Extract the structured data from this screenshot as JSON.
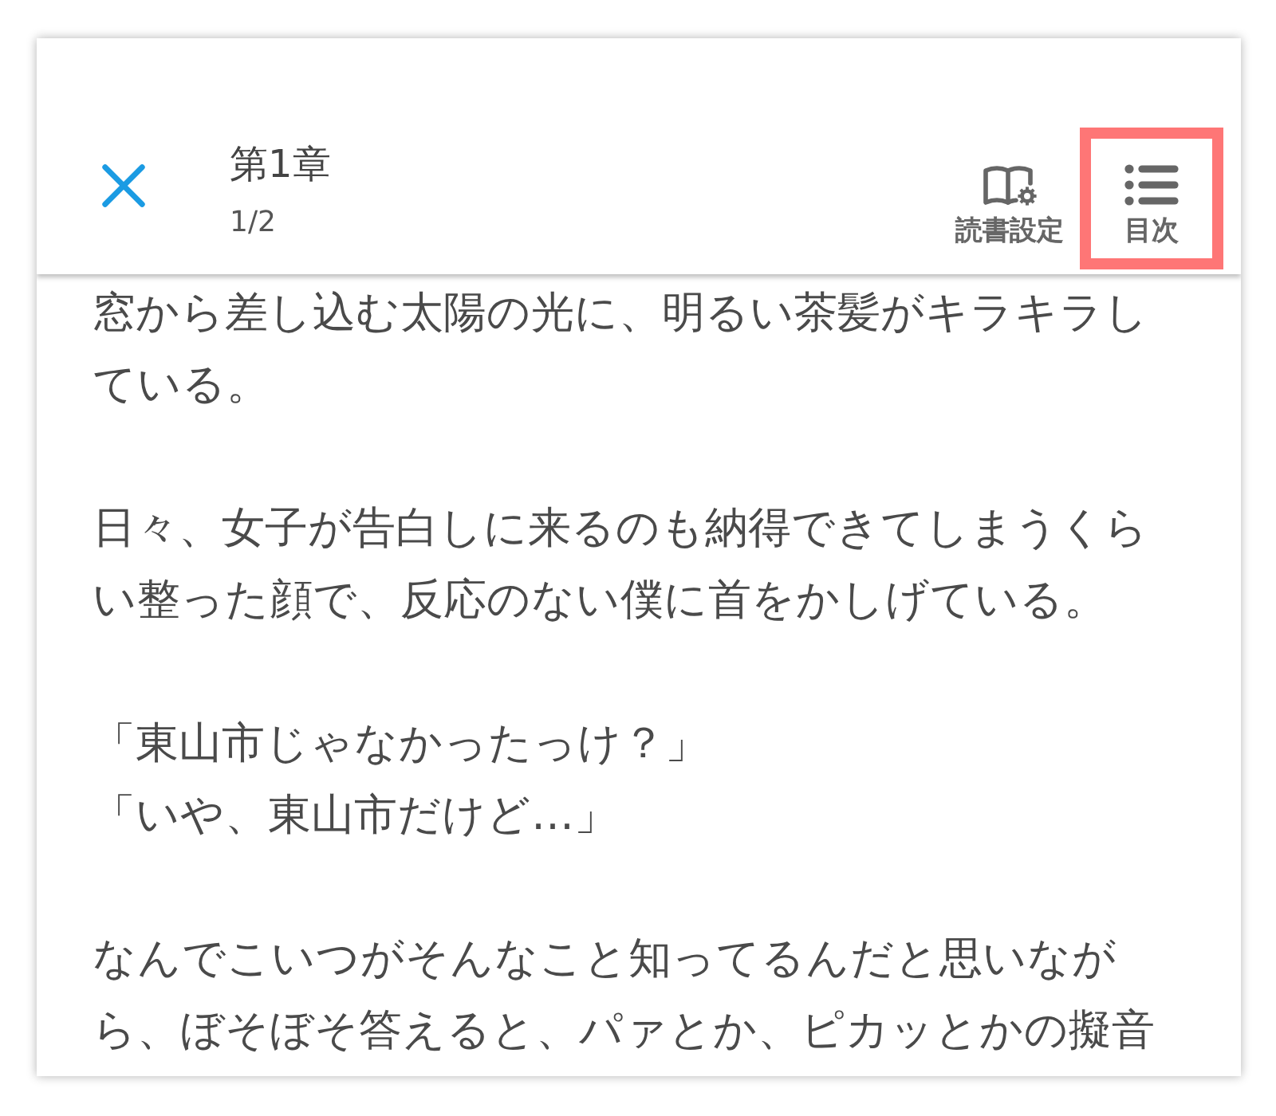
{
  "header": {
    "title": "第1章",
    "page": "1/2",
    "actions": [
      {
        "kind": "reading_settings",
        "label": "読書設定",
        "highlighted": false
      },
      {
        "kind": "contents",
        "label": "目次",
        "highlighted": true
      }
    ]
  },
  "body": [
    {
      "paragraphs": [
        "窓から差し込む太陽の光に、明るい茶髪がキラキラしている。"
      ]
    },
    {
      "paragraphs": [
        "日々、女子が告白しに来るのも納得できてしまうくらい整った顔で、反応のない僕に首をかしげている。"
      ]
    },
    {
      "paragraphs": [
        "「東山市じゃなかったっけ？」",
        "「いや、東山市だけど…」"
      ]
    },
    {
      "paragraphs": [
        "なんでこいつがそんなこと知ってるんだと思いながら、ぼそぼそ答えると、パァとか、ピカッとかの擬音"
      ]
    }
  ]
}
